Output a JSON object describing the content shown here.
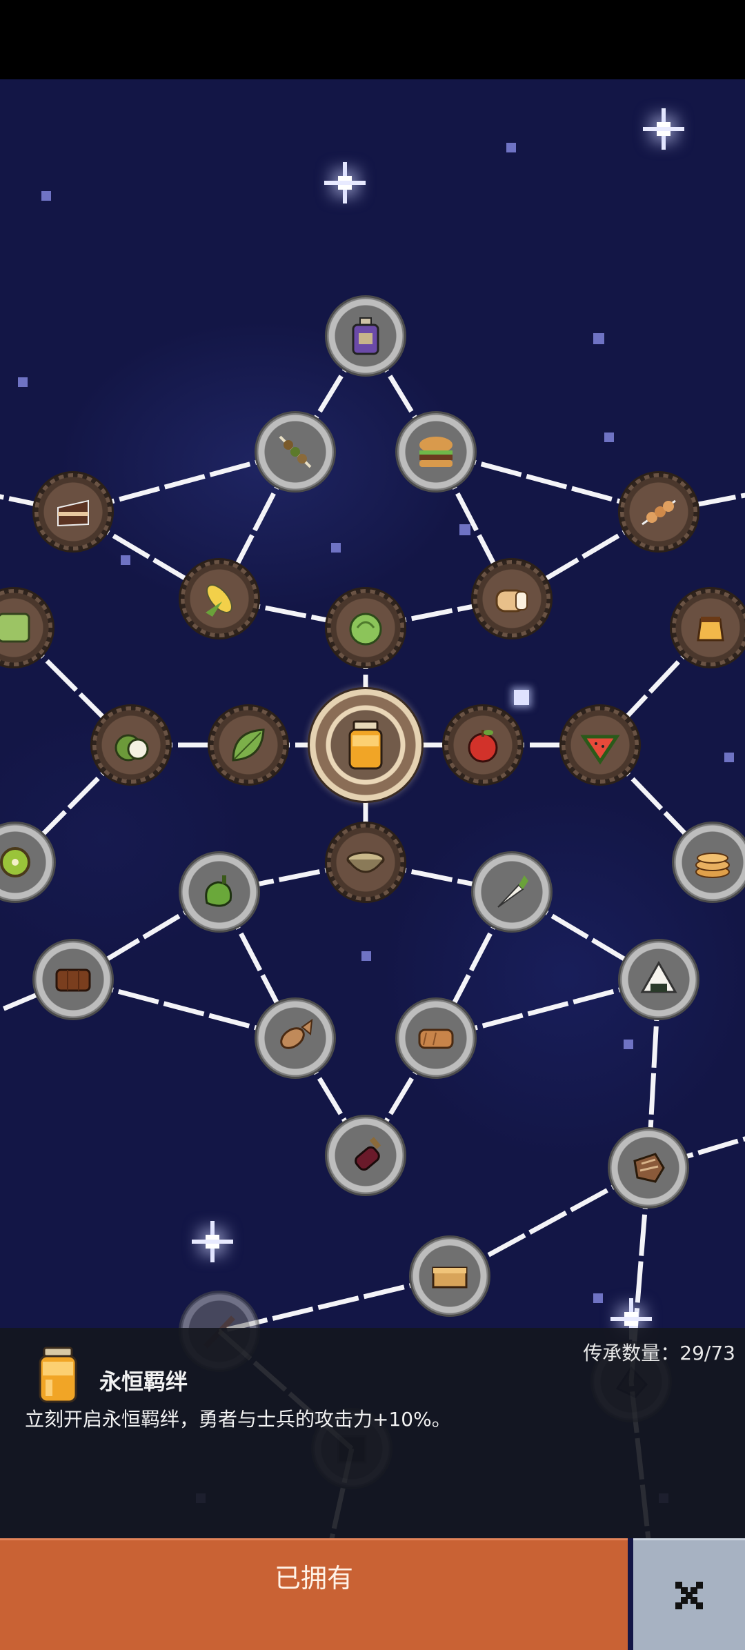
{
  "panel": {
    "title": "永恒羁绊",
    "description": "立刻开启永恒羁绊，勇者与士兵的攻击力+10%。",
    "count_label": "传承数量：29/73"
  },
  "buttons": {
    "owned_label": "已拥有",
    "close_icon": "close-icon"
  },
  "nodes": [
    {
      "name": "node-jam-jar-center",
      "icon": "honey-jar",
      "state": "center"
    },
    {
      "name": "node-purple-jar",
      "icon": "purple-jar",
      "state": "locked"
    },
    {
      "name": "node-kebab",
      "icon": "kebab",
      "state": "locked"
    },
    {
      "name": "node-burger",
      "icon": "burger",
      "state": "locked"
    },
    {
      "name": "node-cake",
      "icon": "cake-slice",
      "state": "owned"
    },
    {
      "name": "node-skewer",
      "icon": "skewer",
      "state": "owned"
    },
    {
      "name": "node-corn",
      "icon": "corn",
      "state": "owned"
    },
    {
      "name": "node-lettuce",
      "icon": "lettuce",
      "state": "owned"
    },
    {
      "name": "node-bread",
      "icon": "bread",
      "state": "owned"
    },
    {
      "name": "node-green-cube",
      "icon": "green-cube",
      "state": "owned"
    },
    {
      "name": "node-pudding",
      "icon": "pudding",
      "state": "owned"
    },
    {
      "name": "node-coconut",
      "icon": "coconut",
      "state": "owned"
    },
    {
      "name": "node-leaf",
      "icon": "leaf",
      "state": "owned"
    },
    {
      "name": "node-apple",
      "icon": "apple",
      "state": "owned"
    },
    {
      "name": "node-watermelon",
      "icon": "watermelon",
      "state": "owned"
    },
    {
      "name": "node-kiwi",
      "icon": "kiwi",
      "state": "locked"
    },
    {
      "name": "node-soup",
      "icon": "soup-bowl",
      "state": "owned"
    },
    {
      "name": "node-pancakes",
      "icon": "pancakes",
      "state": "locked"
    },
    {
      "name": "node-pepper",
      "icon": "pepper",
      "state": "locked"
    },
    {
      "name": "node-radish",
      "icon": "radish",
      "state": "locked"
    },
    {
      "name": "node-chocolate",
      "icon": "chocolate-bar",
      "state": "locked"
    },
    {
      "name": "node-rice-ball",
      "icon": "rice-ball",
      "state": "locked"
    },
    {
      "name": "node-fish",
      "icon": "fish",
      "state": "locked"
    },
    {
      "name": "node-toast",
      "icon": "toast",
      "state": "locked"
    },
    {
      "name": "node-wine",
      "icon": "wine-bottle",
      "state": "locked"
    },
    {
      "name": "node-meat",
      "icon": "meat",
      "state": "locked"
    },
    {
      "name": "node-tofu",
      "icon": "tofu-block",
      "state": "locked"
    },
    {
      "name": "node-stick",
      "icon": "stick",
      "state": "locked"
    },
    {
      "name": "node-dark-stone",
      "icon": "dark-stone",
      "state": "locked"
    },
    {
      "name": "node-black-cube",
      "icon": "black-cube",
      "state": "locked"
    }
  ]
}
